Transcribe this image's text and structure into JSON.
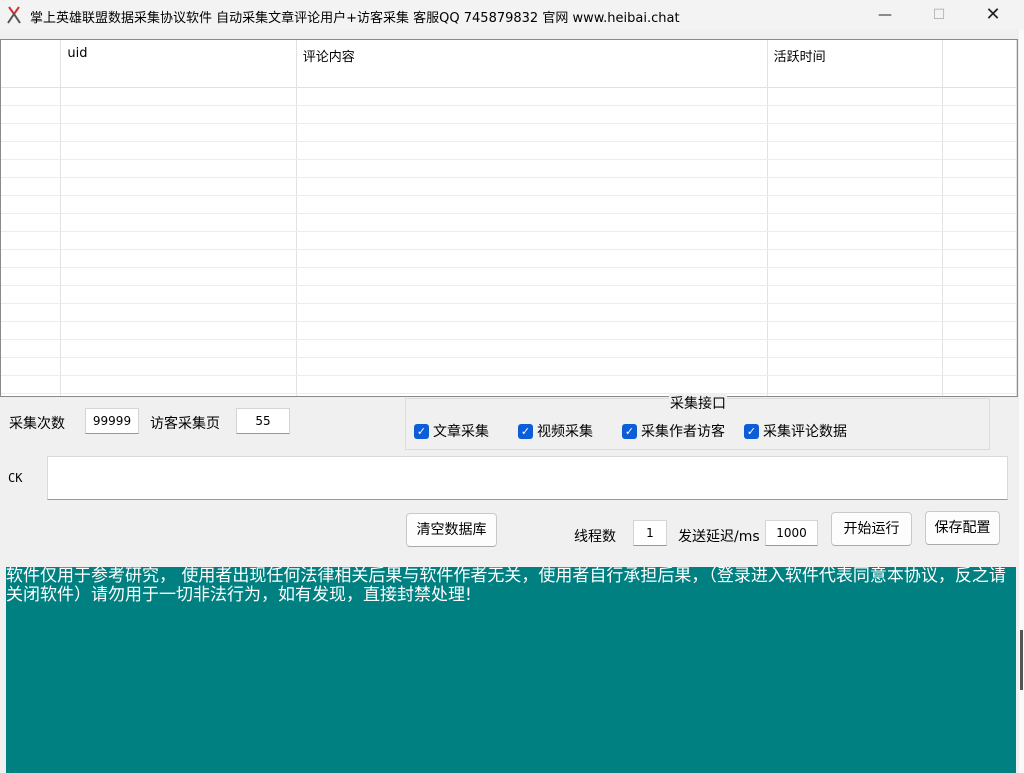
{
  "window": {
    "title": "掌上英雄联盟数据采集协议软件 自动采集文章评论用户+访客采集 客服QQ 745879832 官网 www.heibai.chat",
    "min_glyph": "—",
    "max_glyph": "☐",
    "close_glyph": "✕"
  },
  "table": {
    "columns": [
      "",
      "uid",
      "评论内容",
      "活跃时间",
      ""
    ]
  },
  "form": {
    "collect_count_label": "采集次数",
    "collect_count_value": "99999",
    "visitor_pages_label": "访客采集页",
    "visitor_pages_value": "55",
    "ck_label": "CK",
    "ck_value": "",
    "threads_label": "线程数",
    "threads_value": "1",
    "delay_label": "发送延迟/ms",
    "delay_value": "1000"
  },
  "api_group": {
    "title": "采集接口",
    "options": [
      {
        "label": "文章采集",
        "checked": true
      },
      {
        "label": "视频采集",
        "checked": true
      },
      {
        "label": "采集作者访客",
        "checked": true
      },
      {
        "label": "采集评论数据",
        "checked": true
      }
    ]
  },
  "buttons": {
    "clear_db": "清空数据库",
    "start": "开始运行",
    "save_config": "保存配置"
  },
  "log": {
    "text": "软件仅用于参考研究， 使用者出现任何法律相关后果与软件作者无关，使用者自行承担后果，（登录进入软件代表同意本协议，反之请关闭软件）请勿用于一切非法行为，如有发现，直接封禁处理!"
  },
  "colors": {
    "log_background": "#008080",
    "checkbox": "#0b5ed7"
  }
}
